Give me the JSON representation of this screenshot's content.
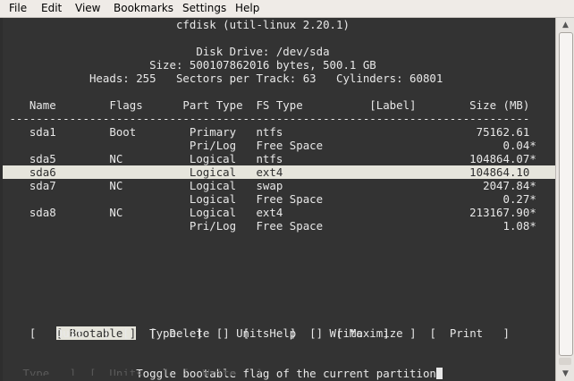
{
  "menu": [
    "File",
    "Edit",
    "View",
    "Bookmarks",
    "Settings",
    "Help"
  ],
  "terminal": {
    "lines": [
      "                          cfdisk (util-linux 2.20.1)",
      "",
      "                             Disk Drive: /dev/sda",
      "                      Size: 500107862016 bytes, 500.1 GB",
      "             Heads: 255   Sectors per Track: 63   Cylinders: 60801",
      "",
      "    Name        Flags      Part Type  FS Type          [Label]        Size (MB)",
      " ------------------------------------------------------------------------------",
      "    sda1        Boot        Primary   ntfs                             75162.61",
      "                            Pri/Log   Free Space                           0.04*",
      "    sda5        NC          Logical   ntfs                            104864.07*",
      "    sda6                    Logical   ext4                            104864.10",
      "    sda7        NC          Logical   swap                              2047.84*",
      "                            Logical   Free Space                           0.27*",
      "    sda8        NC          Logical   ext4                            213167.90*",
      "                            Pri/Log   Free Space                           1.08*"
    ],
    "highlight_row_index": 11,
    "commands_line1": "    [ Bootable ]  [  Delete  ]  [   Help   ]  [ Maximize ]  [  Print   ]",
    "commands_line2": "    [   Quit   ]  [   Type   ]  [  Units   ]  [  Write   ]",
    "active_command": "[ Bootable ]",
    "status": "                Toggle bootable flag of the current partition",
    "ghost_line": "   Type   ]  [  Units   ]  [  Write   ]"
  },
  "colors": {
    "background": "#333333",
    "foreground": "#e8e8e8",
    "highlight": "#e6e5dc"
  }
}
